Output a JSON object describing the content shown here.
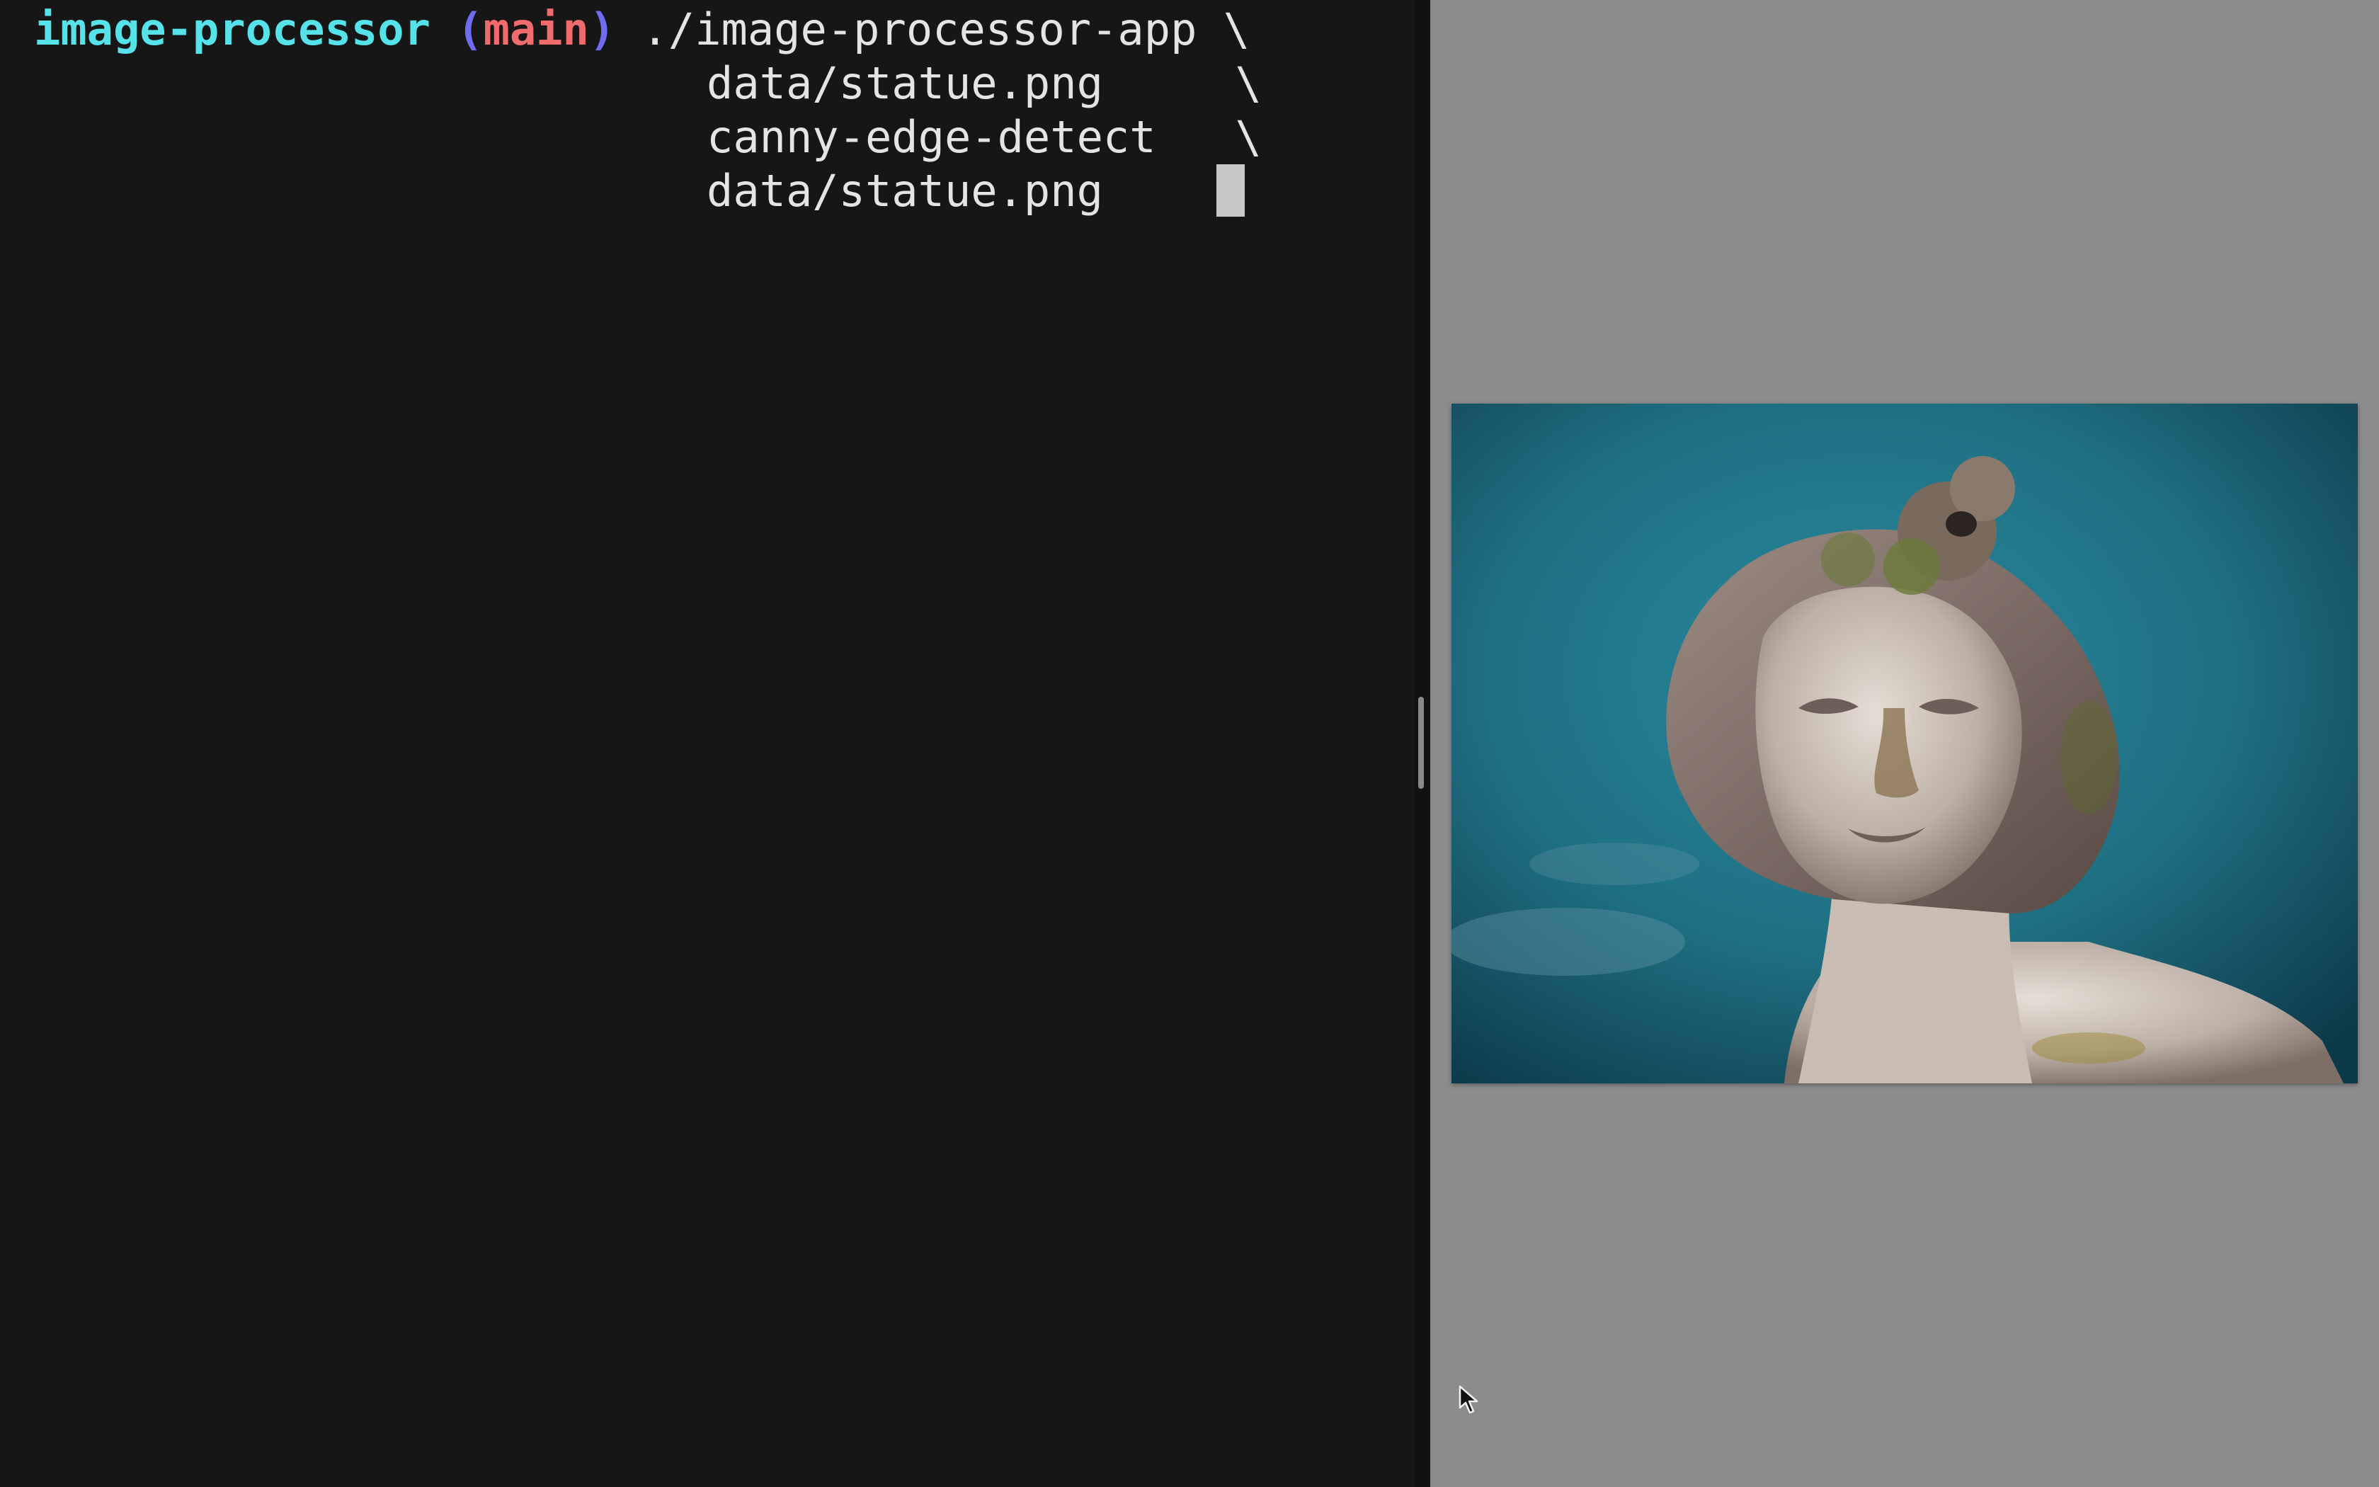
{
  "terminal": {
    "prompt_dir": "image-processor",
    "paren_open": "(",
    "branch": "main",
    "paren_close": ")",
    "command_line_1": " ./image-processor-app \\",
    "command_line_2": "data/statue.png     \\",
    "command_line_3": "canny-edge-detect   \\",
    "command_line_4": "data/statue.png"
  },
  "viewer": {
    "image_subject": "statue-head-photo",
    "sky_color": "#1f6f82",
    "background_color": "#8c8c8c"
  },
  "icons": {
    "cursor": "mouse-pointer-icon"
  }
}
